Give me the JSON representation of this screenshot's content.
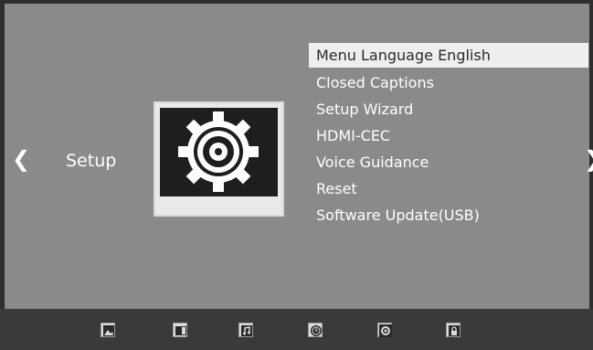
{
  "screen": {
    "section_title": "Setup",
    "left_arrow": "❮",
    "right_arrow": "❯"
  },
  "menu": {
    "items": [
      "Menu Language English",
      "Closed Captions",
      "Setup Wizard",
      "HDMI-CEC",
      "Voice Guidance",
      "Reset",
      "Software Update(USB)"
    ],
    "selected_index": 0
  },
  "dock": {
    "icons": [
      "picture-icon",
      "screen-icon",
      "music-note-icon",
      "clock-icon",
      "setup-target-icon",
      "lock-icon"
    ]
  },
  "colors": {
    "background": "#8a8a8a",
    "selected_bg": "#eeeeee",
    "dock": "#3a3a3a"
  }
}
